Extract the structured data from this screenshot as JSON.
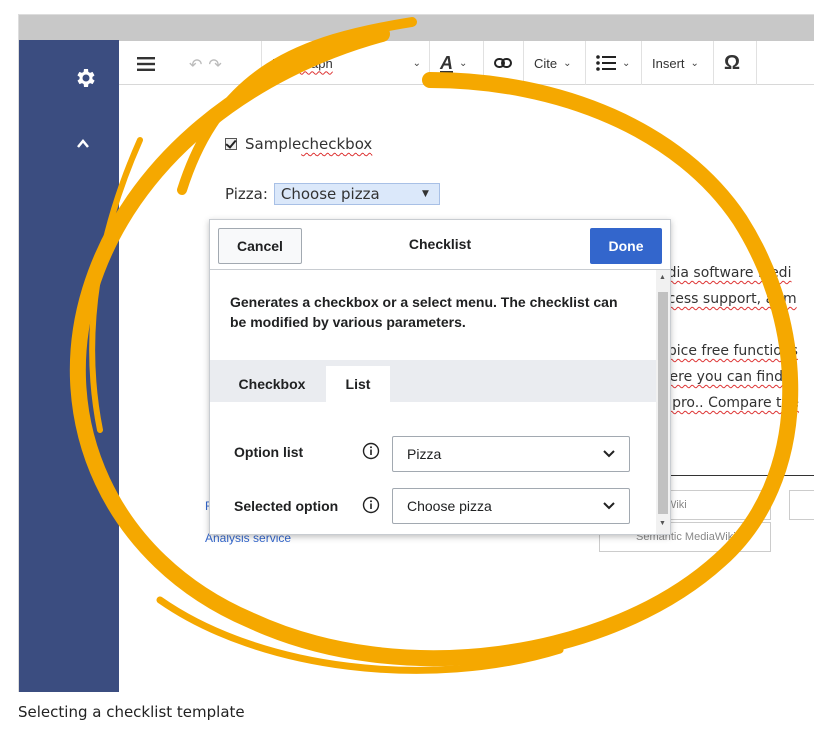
{
  "toolbar": {
    "paragraph_label": "Paragraph",
    "cite_label": "Cite",
    "insert_label": "Insert",
    "omega_symbol": "Ω",
    "text_style_letter": "A"
  },
  "page": {
    "checkbox_label_prefix": "Sample ",
    "checkbox_label_link": "checkbox",
    "pizza_label": "Pizza:",
    "pizza_selected": "Choose pizza"
  },
  "background_text": {
    "line1": "edia software  Medi",
    "line2": "ocess support, adm",
    "line3": "Spice free functions",
    "line4": "Here you can find a",
    "line5": "e pro.. Compare the"
  },
  "footer": {
    "link1": "F",
    "link2": "Analysis service",
    "badge1": "MediaWiki",
    "badge2": "Semantic MediaWiki"
  },
  "dialog": {
    "cancel_label": "Cancel",
    "title": "Checklist",
    "done_label": "Done",
    "description": "Generates a checkbox or a select menu. The checklist can be modified by various parameters.",
    "tabs": [
      {
        "label": "Checkbox",
        "active": false
      },
      {
        "label": "List",
        "active": true
      }
    ],
    "fields": [
      {
        "label": "Option list",
        "value": "Pizza"
      },
      {
        "label": "Selected option",
        "value": "Choose pizza"
      }
    ]
  },
  "caption": "Selecting a checklist template",
  "colors": {
    "sidebar": "#3b4d80",
    "primary_button": "#3366cc",
    "highlight_swirl": "#f5a800",
    "select_highlight": "#dbe8fa"
  }
}
